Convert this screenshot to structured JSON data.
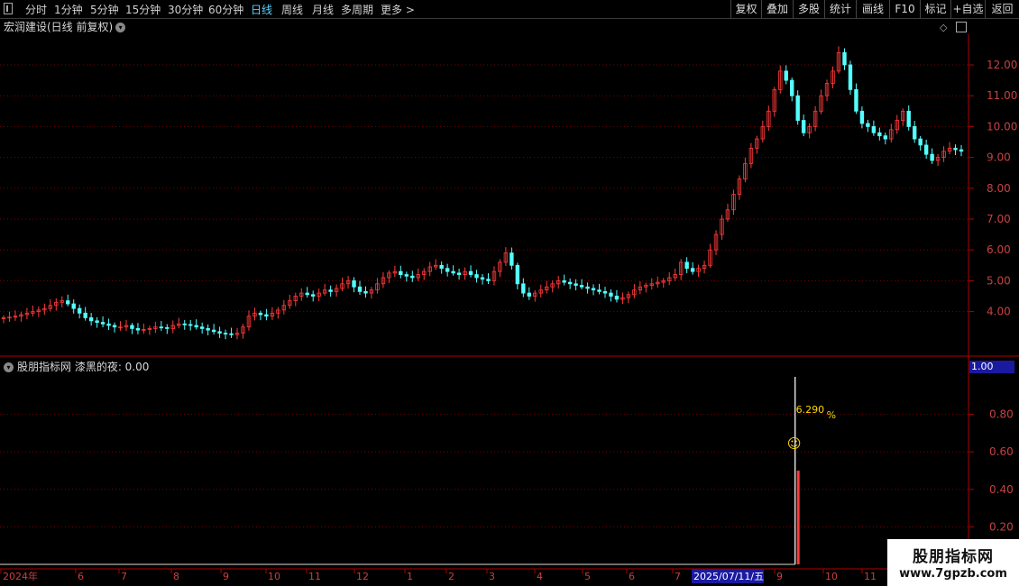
{
  "toolbar": {
    "timeframes": [
      "分时",
      "1分钟",
      "5分钟",
      "15分钟",
      "30分钟",
      "60分钟",
      "日线",
      "周线",
      "月线",
      "多周期",
      "更多 >"
    ],
    "active": "日线",
    "right_buttons": [
      "复权",
      "叠加",
      "多股",
      "统计",
      "画线",
      "F10",
      "标记",
      "+自选",
      "返回"
    ]
  },
  "stock_title": "宏润建设(日线 前复权)",
  "price_axis": [
    "12.00",
    "11.00",
    "10.00",
    "9.00",
    "8.00",
    "7.00",
    "6.00",
    "5.00",
    "4.00"
  ],
  "indicator": {
    "title": "股朋指标网 漆黑的夜: 0.00",
    "current_value": "1.00",
    "axis": [
      "0.80",
      "0.60",
      "0.40",
      "0.20"
    ],
    "annotation_value": "6.290",
    "annotation_unit": "%",
    "smiley": "☺"
  },
  "date_axis": {
    "labels": [
      "2024年",
      "6",
      "7",
      "8",
      "9",
      "10",
      "11",
      "12",
      "1",
      "2",
      "3",
      "4",
      "5",
      "6",
      "7",
      "9",
      "10",
      "11"
    ],
    "cursor_date": "2025/07/11/五"
  },
  "watermark": {
    "line1": "股朋指标网",
    "line2": "www.7gpzb.com"
  },
  "colors": {
    "up": "#ff3b3b",
    "down": "#54ffff",
    "axis": "#b00000",
    "grid": "#7a0000",
    "cursor_bg": "#1a1aa0"
  },
  "chart_data": {
    "type": "candlestick",
    "ylim": [
      3.0,
      13.0
    ],
    "closes": [
      3.8,
      3.82,
      3.85,
      3.9,
      3.95,
      4.0,
      4.05,
      4.1,
      4.2,
      4.3,
      4.35,
      4.25,
      4.1,
      3.95,
      3.8,
      3.7,
      3.65,
      3.6,
      3.55,
      3.5,
      3.5,
      3.55,
      3.45,
      3.4,
      3.42,
      3.45,
      3.5,
      3.48,
      3.45,
      3.55,
      3.6,
      3.58,
      3.55,
      3.5,
      3.45,
      3.4,
      3.35,
      3.3,
      3.28,
      3.25,
      3.3,
      3.5,
      3.85,
      3.95,
      3.9,
      3.85,
      3.95,
      4.05,
      4.2,
      4.35,
      4.5,
      4.6,
      4.55,
      4.5,
      4.6,
      4.7,
      4.65,
      4.75,
      4.9,
      5.0,
      4.8,
      4.65,
      4.6,
      4.7,
      4.9,
      5.1,
      5.25,
      5.3,
      5.2,
      5.15,
      5.1,
      5.2,
      5.3,
      5.45,
      5.5,
      5.4,
      5.3,
      5.25,
      5.2,
      5.3,
      5.2,
      5.1,
      5.05,
      5.0,
      5.3,
      5.6,
      5.9,
      5.5,
      4.9,
      4.6,
      4.5,
      4.6,
      4.7,
      4.8,
      4.9,
      5.0,
      4.95,
      4.9,
      4.85,
      4.8,
      4.75,
      4.7,
      4.65,
      4.6,
      4.5,
      4.4,
      4.45,
      4.55,
      4.7,
      4.8,
      4.85,
      4.9,
      4.95,
      5.0,
      5.1,
      5.2,
      5.6,
      5.4,
      5.3,
      5.4,
      5.5,
      6.0,
      6.5,
      7.0,
      7.3,
      7.8,
      8.3,
      8.8,
      9.3,
      9.6,
      10.0,
      10.5,
      11.2,
      11.8,
      11.5,
      11.0,
      10.2,
      9.8,
      10.0,
      10.5,
      11.0,
      11.4,
      11.8,
      12.4,
      12.0,
      11.2,
      10.5,
      10.1,
      10.0,
      9.8,
      9.7,
      9.6,
      9.9,
      10.2,
      10.5,
      10.0,
      9.6,
      9.4,
      9.1,
      8.9,
      9.0,
      9.2,
      9.3,
      9.25,
      9.2
    ],
    "indicator_values": {
      "spike_index": 136,
      "spike_value": 1.0,
      "bar_value": 0.5
    }
  }
}
